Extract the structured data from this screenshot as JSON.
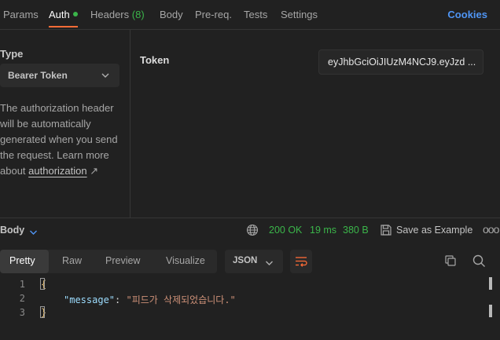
{
  "request_tabs": [
    {
      "label": "Params"
    },
    {
      "label": "Auth",
      "active": true,
      "indicator": "green-dot"
    },
    {
      "label": "Headers",
      "count": "(8)"
    },
    {
      "label": "Body"
    },
    {
      "label": "Pre-req."
    },
    {
      "label": "Tests"
    },
    {
      "label": "Settings"
    }
  ],
  "cookies_label": "Cookies",
  "auth": {
    "type_label": "Type",
    "type_value": "Bearer Token",
    "description_pre": "The authorization header will be automatically generated when you send the request. Learn more about ",
    "description_link": "authorization",
    "description_link_icon": "↗",
    "token_label": "Token",
    "token_value": "eyJhbGciOiJIUzM4NCJ9.eyJzd ..."
  },
  "response": {
    "tab_label": "Body",
    "status": "200 OK",
    "time": "19 ms",
    "size": "380 B",
    "save_label": "Save as Example",
    "more_label": "ooo",
    "views": [
      "Pretty",
      "Raw",
      "Preview",
      "Visualize"
    ],
    "active_view": "Pretty",
    "format": "JSON",
    "code": {
      "line_numbers": [
        "1",
        "2",
        "3"
      ],
      "open_brace": "{",
      "key": "\"message\"",
      "colon": ": ",
      "value": "\"피드가 삭제되었습니다.\"",
      "close_brace": "}"
    }
  },
  "colors": {
    "accent": "#ff6c37",
    "success": "#3bb54a",
    "link": "#4f95f4",
    "background": "#212121"
  }
}
